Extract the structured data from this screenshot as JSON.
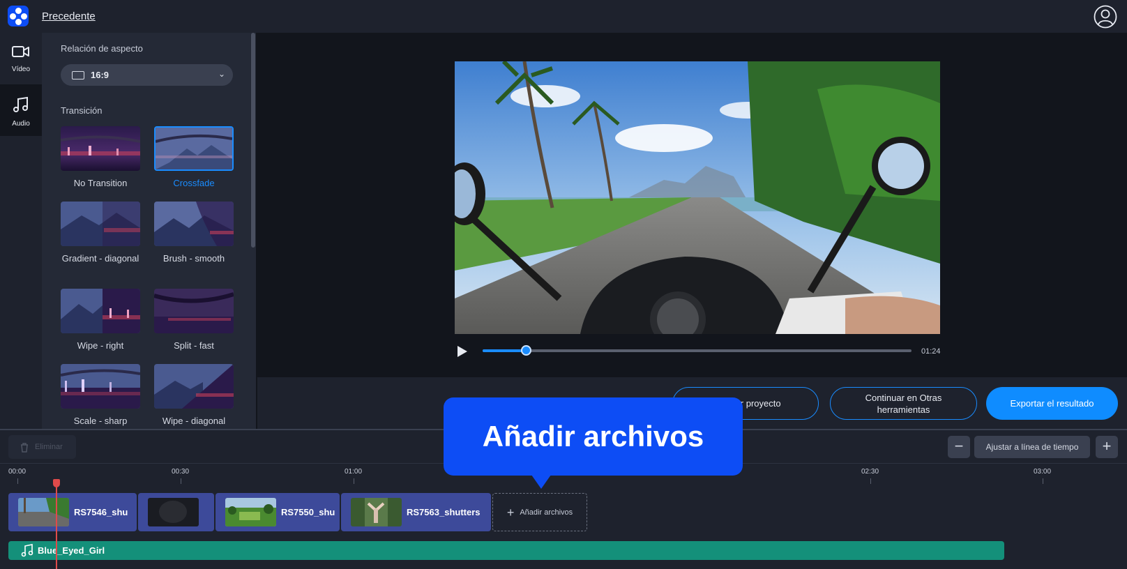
{
  "header": {
    "back_link": "Precedente"
  },
  "rail": {
    "video_label": "Vídeo",
    "audio_label": "Audio"
  },
  "panel": {
    "aspect_title": "Relación de aspecto",
    "aspect_value": "16:9",
    "transition_title": "Transición",
    "transitions": [
      {
        "label": "No Transition",
        "selected": false
      },
      {
        "label": "Crossfade",
        "selected": true
      },
      {
        "label": "Gradient - diagonal",
        "selected": false
      },
      {
        "label": "Brush - smooth",
        "selected": false
      },
      {
        "label": "Wipe - right",
        "selected": false
      },
      {
        "label": "Split - fast",
        "selected": false
      },
      {
        "label": "Scale - sharp",
        "selected": false
      },
      {
        "label": "Wipe - diagonal",
        "selected": false
      }
    ]
  },
  "player": {
    "time": "01:24",
    "progress": 0.1
  },
  "actions": {
    "save_project": "Guardar proyecto",
    "continue_other_tools": "Continuar en Otras herramientas",
    "export": "Exportar el resultado"
  },
  "timeline": {
    "delete_label": "Eliminar",
    "zoom_out": "−",
    "fit_label": "Ajustar a línea de tiempo",
    "zoom_in": "+",
    "ticks": [
      "00:00",
      "00:30",
      "01:00",
      "02:30",
      "03:00"
    ],
    "clips": [
      {
        "name": "RS7546_shu"
      },
      {
        "name": ""
      },
      {
        "name": "RS7550_shu"
      },
      {
        "name": "RS7563_shutters"
      }
    ],
    "add_files": "Añadir archivos",
    "audio_track": "Blue_Eyed_Girl"
  },
  "callout": {
    "text": "Añadir archivos"
  },
  "colors": {
    "accent": "#1a8cff",
    "brand": "#0d4df5",
    "audio": "#14907a",
    "clip": "#3d4a9a"
  }
}
